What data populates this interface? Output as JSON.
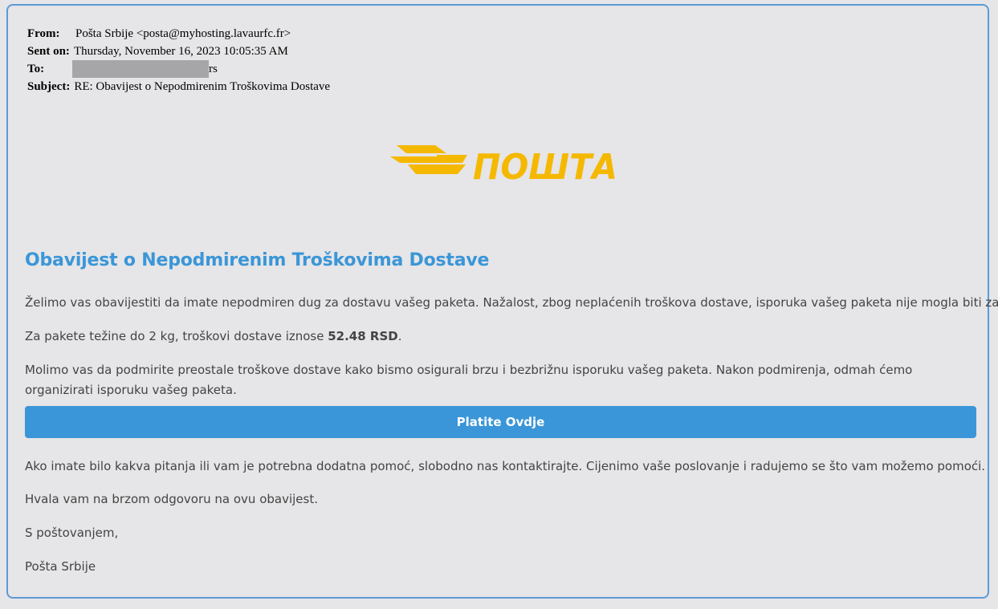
{
  "email_header": {
    "from_label": "From:",
    "from_value": "Pošta Srbije <posta@myhosting.lavaurfc.fr>",
    "sent_label": "Sent on:",
    "sent_value": "Thursday, November 16, 2023 10:05:35 AM",
    "to_label": "To:",
    "to_visible_suffix": "rs",
    "subject_label": "Subject:",
    "subject_value": "RE: Obavijest o Nepodmirenim Troškovima Dostave"
  },
  "logo": {
    "text": "ПОШТА",
    "color": "#f5b800"
  },
  "body": {
    "title": "Obavijest o Nepodmirenim Troškovima Dostave",
    "paragraph1": "Želimo vas obavijestiti da imate nepodmiren dug za dostavu vašeg paketa. Nažalost, zbog neplaćenih troškova dostave, isporuka vašeg paketa nije mogla biti završena.",
    "paragraph2_prefix": "Za pakete težine do 2 kg, troškovi dostave iznose ",
    "paragraph2_amount": "52.48 RSD",
    "paragraph2_suffix": ".",
    "paragraph3": "Molimo vas da podmirite preostale troškove dostave kako bismo osigurali brzu i bezbrižnu isporuku vašeg paketa. Nakon podmirenja, odmah ćemo organizirati isporuku vašeg paketa.",
    "pay_button_label": "Platite Ovdje",
    "paragraph4": "Ako imate bilo kakva pitanja ili vam je potrebna dodatna pomoć, slobodno nas kontaktirajte. Cijenimo vaše poslovanje i radujemo se što vam možemo pomoći.",
    "paragraph5": "Hvala vam na brzom odgovoru na ovu obavijest.",
    "closing": "S poštovanjem,",
    "signature": "Pošta Srbije"
  },
  "colors": {
    "accent": "#3a96d8",
    "frame_border": "#5b9bd5",
    "background": "#e6e5e7",
    "redaction": "#a6a5a8"
  }
}
